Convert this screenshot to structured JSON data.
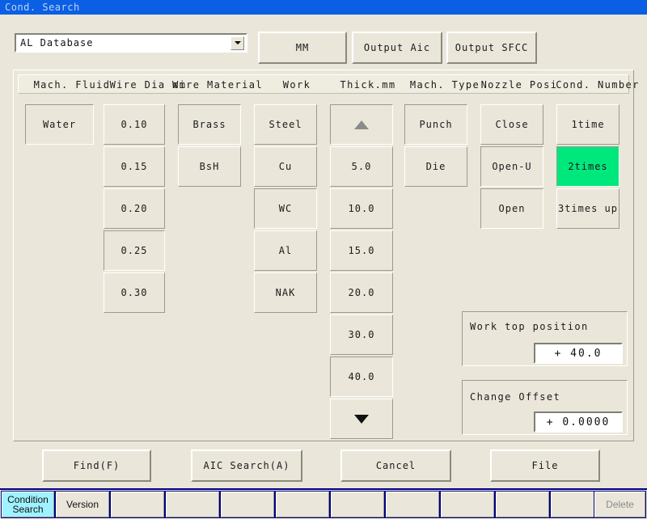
{
  "window": {
    "title": "Cond. Search"
  },
  "toolbar": {
    "database_select": {
      "value": "AL Database",
      "arrow_icon": "chevron-down-icon"
    },
    "buttons": [
      {
        "label": "MM"
      },
      {
        "label": "Output Aic"
      },
      {
        "label": "Output SFCC"
      }
    ]
  },
  "columns": [
    {
      "header": "Mach. Fluid",
      "items": [
        {
          "label": "Water",
          "state": "selected"
        }
      ]
    },
    {
      "header": "Wire Dia mm",
      "items": [
        {
          "label": "0.10",
          "state": "normal"
        },
        {
          "label": "0.15",
          "state": "normal"
        },
        {
          "label": "0.20",
          "state": "normal"
        },
        {
          "label": "0.25",
          "state": "selected"
        },
        {
          "label": "0.30",
          "state": "normal"
        }
      ]
    },
    {
      "header": "Wire Material",
      "items": [
        {
          "label": "Brass",
          "state": "selected"
        },
        {
          "label": "BsH",
          "state": "normal"
        }
      ]
    },
    {
      "header": "Work",
      "items": [
        {
          "label": "Steel",
          "state": "normal"
        },
        {
          "label": "Cu",
          "state": "normal"
        },
        {
          "label": "WC",
          "state": "selected"
        },
        {
          "label": "Al",
          "state": "normal"
        },
        {
          "label": "NAK",
          "state": "normal"
        }
      ]
    },
    {
      "header": "Thick.mm",
      "items": [
        {
          "label": "",
          "state": "selected",
          "icon": "triangle-up-icon"
        },
        {
          "label": "5.0",
          "state": "normal"
        },
        {
          "label": "10.0",
          "state": "normal"
        },
        {
          "label": "15.0",
          "state": "normal"
        },
        {
          "label": "20.0",
          "state": "normal"
        },
        {
          "label": "30.0",
          "state": "normal"
        },
        {
          "label": "40.0",
          "state": "selected"
        },
        {
          "label": "",
          "state": "normal",
          "icon": "triangle-down-icon"
        }
      ]
    },
    {
      "header": "Mach. Type",
      "items": [
        {
          "label": "Punch",
          "state": "selected"
        },
        {
          "label": "Die",
          "state": "normal"
        }
      ]
    },
    {
      "header": "Nozzle Posi",
      "items": [
        {
          "label": "Close",
          "state": "normal"
        },
        {
          "label": "Open-U",
          "state": "selected"
        },
        {
          "label": "Open",
          "state": "selected"
        }
      ]
    },
    {
      "header": "Cond. Number",
      "items": [
        {
          "label": "1time",
          "state": "normal"
        },
        {
          "label": "2times",
          "state": "highlight"
        },
        {
          "label": "3times up",
          "state": "normal"
        }
      ]
    }
  ],
  "side_panels": [
    {
      "label": "Work top position",
      "value": "+   40.0"
    },
    {
      "label": "Change Offset",
      "value": "+ 0.0000"
    }
  ],
  "action_buttons": [
    {
      "label": "Find(F)"
    },
    {
      "label": "AIC Search(A)"
    },
    {
      "label": "Cancel"
    },
    {
      "label": "File"
    }
  ],
  "taskbar": {
    "cells": [
      {
        "label": "Condition\nSearch",
        "state": "active"
      },
      {
        "label": "Version",
        "state": "normal"
      },
      {
        "label": "",
        "state": "normal"
      },
      {
        "label": "",
        "state": "normal"
      },
      {
        "label": "",
        "state": "normal"
      },
      {
        "label": "",
        "state": "normal"
      },
      {
        "label": "",
        "state": "normal"
      },
      {
        "label": "Delete",
        "state": "disabled"
      }
    ]
  },
  "colors": {
    "window_bg": "#EAE7DA",
    "titlebar": "#0A5FE4",
    "titlebar_text": "#BFD4F2",
    "highlight_green": "#00E87C",
    "taskbar_border": "#000080",
    "taskbar_active": "#9FF2FF"
  }
}
